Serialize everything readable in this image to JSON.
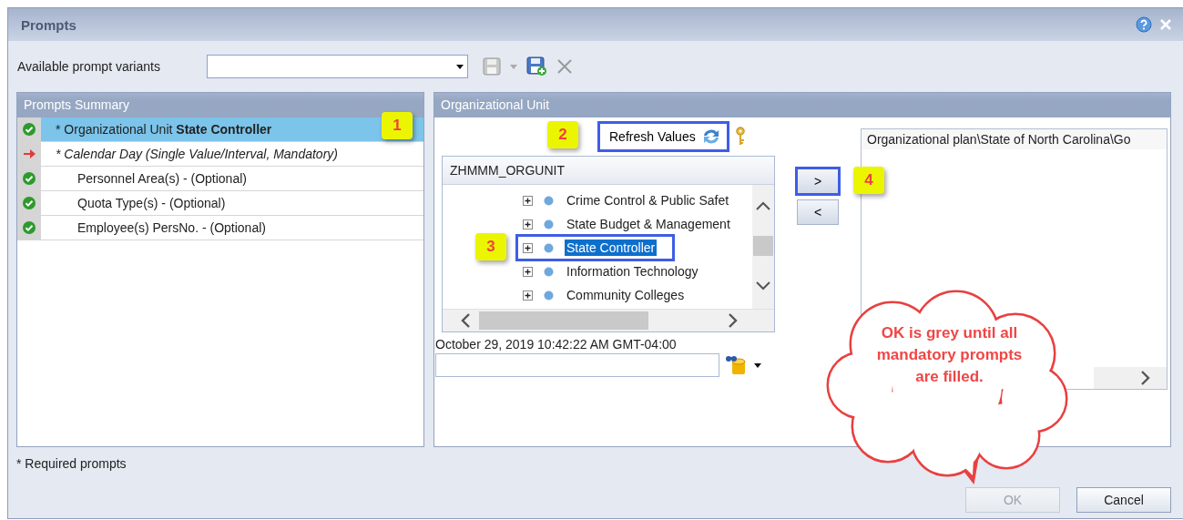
{
  "window": {
    "title": "Prompts"
  },
  "variants": {
    "label": "Available prompt variants"
  },
  "summary": {
    "title": "Prompts Summary",
    "items": [
      {
        "text": "* Organizational Unit **State Controller**",
        "filled": true,
        "required": true,
        "selected": true,
        "badge": "1"
      },
      {
        "text": "* Calendar Day (Single Value/Interval, Mandatory)",
        "filled": false,
        "required": true,
        "selected": false
      },
      {
        "text": "Personnel Area(s) - (Optional)",
        "filled": true,
        "required": false,
        "selected": false
      },
      {
        "text": "Quota Type(s) - (Optional)",
        "filled": true,
        "required": false,
        "selected": false
      },
      {
        "text": "Employee(s) PersNo. - (Optional)",
        "filled": true,
        "required": false,
        "selected": false
      }
    ]
  },
  "org": {
    "title": "Organizational Unit",
    "refresh": {
      "label": "Refresh Values",
      "highlighted": true,
      "badge": "2"
    },
    "tree": {
      "header": "ZHMMM_ORGUNIT",
      "nodes": [
        {
          "label": "Crime Control & Public Safet",
          "selected": false,
          "highlighted": false
        },
        {
          "label": "State Budget & Management",
          "selected": false,
          "highlighted": false
        },
        {
          "label": "State Controller",
          "selected": true,
          "highlighted": true,
          "badge": "3"
        },
        {
          "label": "Information Technology",
          "selected": false,
          "highlighted": false
        },
        {
          "label": "Community Colleges",
          "selected": false,
          "highlighted": false
        }
      ]
    },
    "timestamp": "October 29, 2019 10:42:22 AM GMT-04:00",
    "move_buttons": [
      {
        "label": ">",
        "highlighted": true,
        "badge": "4"
      },
      {
        "label": "<",
        "highlighted": false
      }
    ],
    "selected_values": [
      "Organizational plan\\State of North Carolina\\Go"
    ]
  },
  "callout": {
    "text": "OK is grey until all mandatory prompts are filled."
  },
  "footer": {
    "note": "* Required prompts",
    "buttons": [
      {
        "label": "OK",
        "disabled": true
      },
      {
        "label": "Cancel",
        "disabled": false
      }
    ]
  }
}
